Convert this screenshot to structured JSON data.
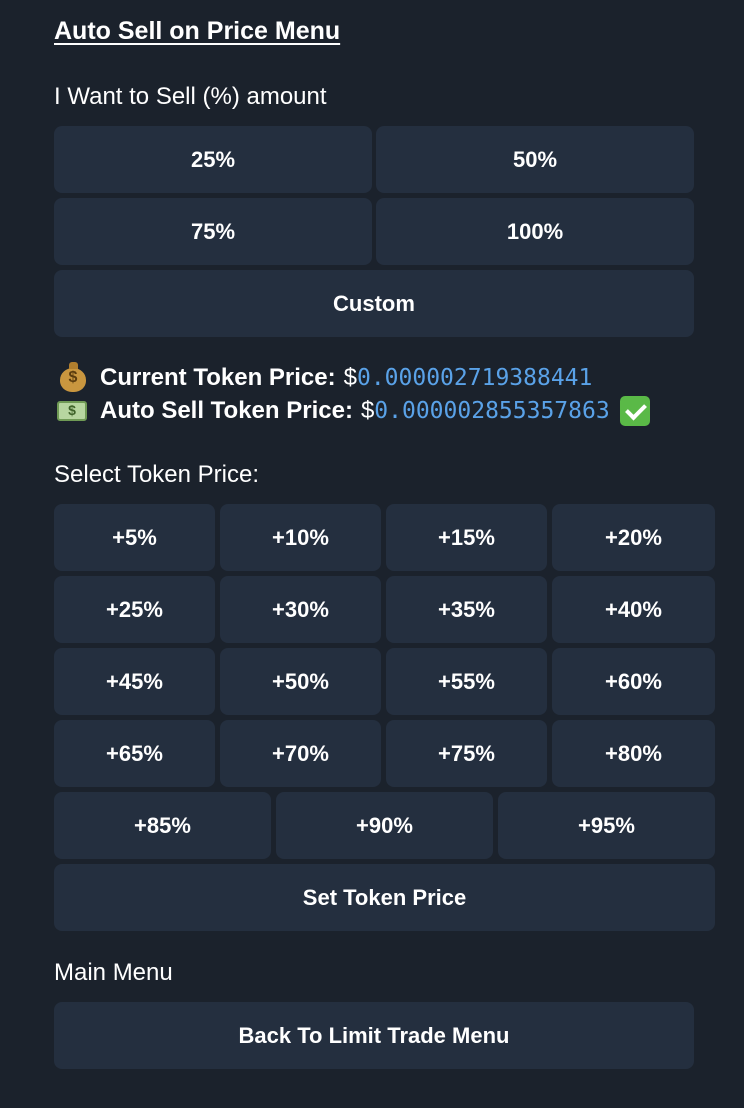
{
  "header": {
    "title": "Auto Sell on Price Menu"
  },
  "sell_amount": {
    "label": "I Want to Sell (%) amount",
    "options": [
      "25%",
      "50%",
      "75%",
      "100%"
    ],
    "custom_label": "Custom"
  },
  "prices": {
    "current_label": "Current Token Price:",
    "current_currency": "$",
    "current_value": "0.000002719388441",
    "auto_label": "Auto Sell Token Price:",
    "auto_currency": "$",
    "auto_value": "0.000002855357863",
    "current_icon": "money-bag-icon",
    "auto_icon": "banknote-icon",
    "confirm_icon": "check-mark-icon"
  },
  "token_price": {
    "label": "Select Token Price:",
    "options": [
      "+5%",
      "+10%",
      "+15%",
      "+20%",
      "+25%",
      "+30%",
      "+35%",
      "+40%",
      "+45%",
      "+50%",
      "+55%",
      "+60%",
      "+65%",
      "+70%",
      "+75%",
      "+80%",
      "+85%",
      "+90%",
      "+95%"
    ],
    "set_label": "Set Token Price"
  },
  "main_menu": {
    "label": "Main Menu",
    "back_label": "Back To Limit Trade Menu"
  },
  "colors": {
    "background": "#1b222c",
    "button": "#242f3f",
    "accent": "#5aa2e8",
    "check": "#5ab947"
  }
}
